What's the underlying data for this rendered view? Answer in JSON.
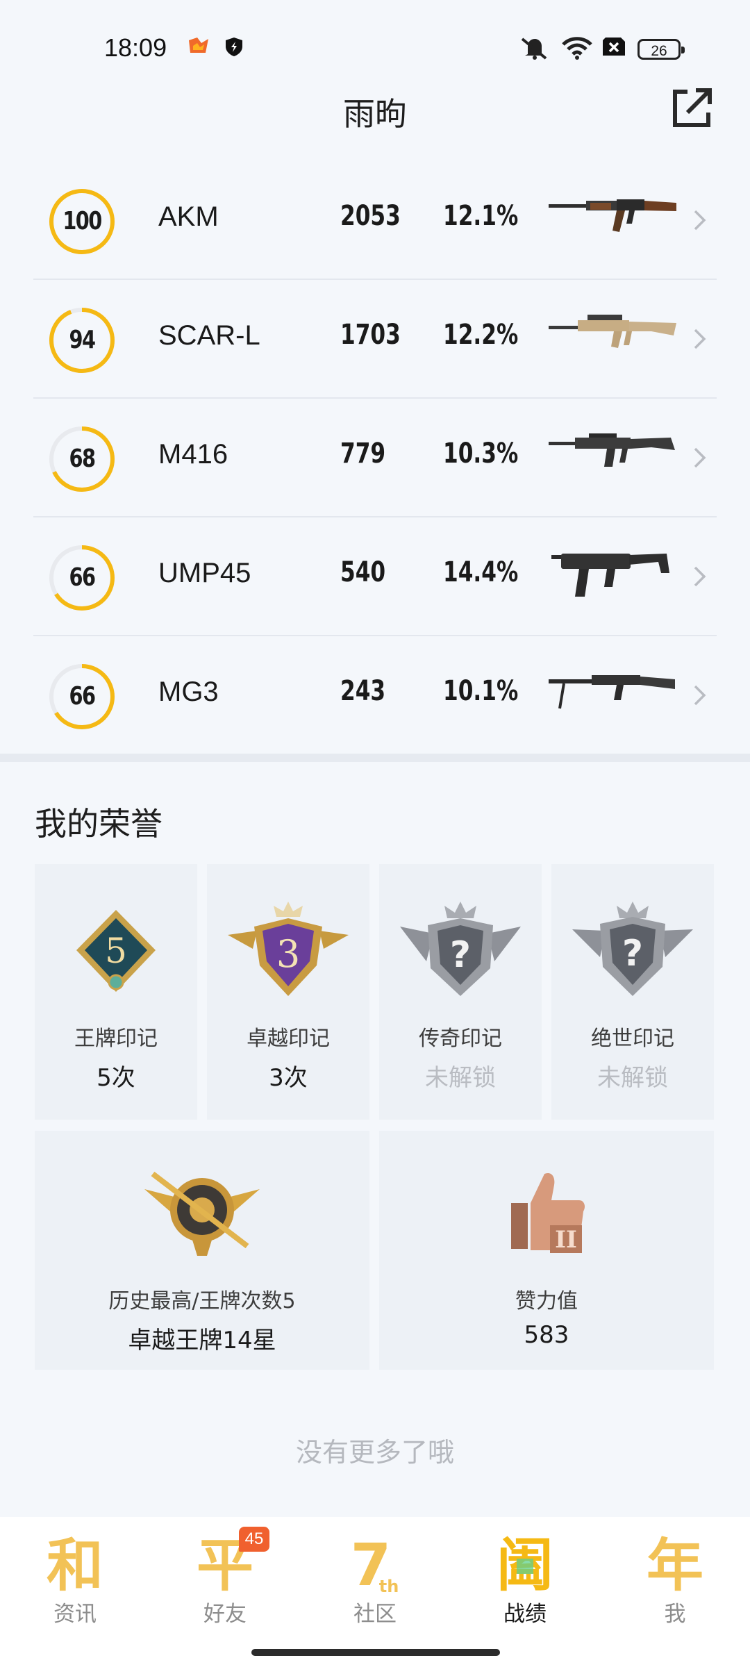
{
  "status_bar": {
    "time": "18:09",
    "battery": "26"
  },
  "header": {
    "title": "雨昫"
  },
  "weapons": [
    {
      "score": "100",
      "score_value": 100,
      "name": "AKM",
      "count": "2053",
      "rate": "12.1%"
    },
    {
      "score": "94",
      "score_value": 94,
      "name": "SCAR-L",
      "count": "1703",
      "rate": "12.2%"
    },
    {
      "score": "68",
      "score_value": 68,
      "name": "M416",
      "count": "779",
      "rate": "10.3%"
    },
    {
      "score": "66",
      "score_value": 66,
      "name": "UMP45",
      "count": "540",
      "rate": "14.4%"
    },
    {
      "score": "66",
      "score_value": 66,
      "name": "MG3",
      "count": "243",
      "rate": "10.1%"
    }
  ],
  "honors": {
    "title": "我的荣誉",
    "cards": [
      {
        "label": "王牌印记",
        "value": "5次",
        "badge_text": "5"
      },
      {
        "label": "卓越印记",
        "value": "3次",
        "badge_text": "3"
      },
      {
        "label": "传奇印记",
        "value": "未解锁",
        "badge_text": "?"
      },
      {
        "label": "绝世印记",
        "value": "未解锁",
        "badge_text": "?"
      }
    ],
    "history": {
      "label": "历史最高/王牌次数5",
      "value": "卓越王牌14星"
    },
    "likes": {
      "label": "赞力值",
      "value": "583"
    }
  },
  "footer": {
    "no_more": "没有更多了哦"
  },
  "tabs": [
    {
      "label": "资讯",
      "glyph": "和",
      "active": false
    },
    {
      "label": "好友",
      "glyph": "平",
      "badge": "45",
      "active": false
    },
    {
      "label": "社区",
      "glyph": "7",
      "glyph_sub": "th",
      "active": false
    },
    {
      "label": "战绩",
      "glyph": "阖",
      "active": true
    },
    {
      "label": "我",
      "glyph": "年",
      "active": false
    }
  ],
  "colors": {
    "accent": "#f5b914",
    "tab_gold": "#f2c256",
    "badge_red": "#f0602e",
    "background": "#f4f7fb"
  }
}
